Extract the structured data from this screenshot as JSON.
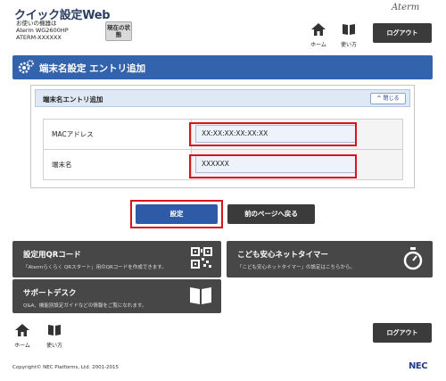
{
  "header": {
    "site_title": "クイック設定Web",
    "device_label": "お使いの機器は",
    "device_model": "Aterm WG2600HP",
    "device_id": "ATERM-XXXXXX",
    "status_button": "現在の状態",
    "brand": "Aterm",
    "home_label": "ホーム",
    "manual_label": "使い方",
    "logout_label": "ログアウト"
  },
  "page": {
    "title": "端末名設定 エントリ追加",
    "section_title": "端末名エントリ追加",
    "collapse_label": "閉じる"
  },
  "form": {
    "mac_label": "MACアドレス",
    "mac_value": "XX:XX:XX:XX:XX:XX",
    "name_label": "端末名",
    "name_value": "XXXXXX"
  },
  "actions": {
    "submit_label": "設定",
    "back_label": "前のページへ戻る"
  },
  "tiles": {
    "qr_title": "設定用QRコード",
    "qr_desc": "「Atermらくらく QRスタート」用のQRコードを作成できます。",
    "timer_title": "こども安心ネットタイマー",
    "timer_desc": "「こども安心ネットタイマー」の設定はこちらから。",
    "support_title": "サポートデスク",
    "support_desc": "Q&A、機能別設定ガイドなどの情報をご覧になれます。"
  },
  "footer": {
    "home_label": "ホーム",
    "manual_label": "使い方",
    "logout_label": "ログアウト",
    "copyright": "Copyright© NEC Platforms, Ltd. 2001-2015",
    "nec_logo": "NEC"
  },
  "colors": {
    "title_bar": "#3463ad",
    "highlight": "#d9121b",
    "tile_bg": "#474747"
  }
}
